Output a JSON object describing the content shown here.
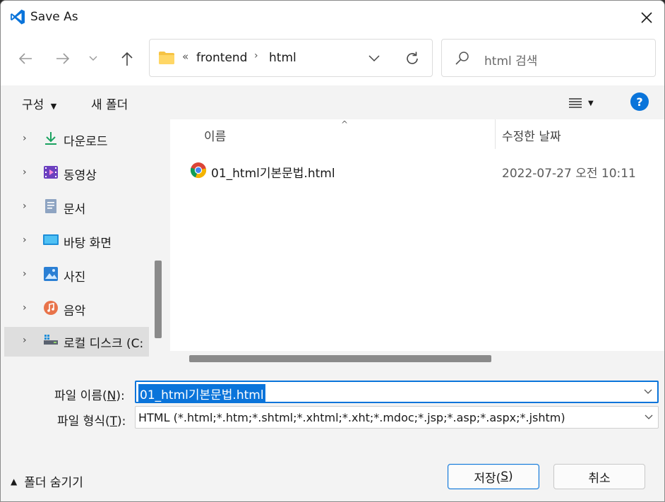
{
  "window": {
    "title": "Save As",
    "app_icon": "vscode-icon"
  },
  "nav": {
    "back_icon": "back-arrow-icon",
    "forward_icon": "forward-arrow-icon",
    "recent_icon": "chevron-down-icon",
    "up_icon": "up-arrow-icon"
  },
  "address": {
    "overflow": "«",
    "crumbs": [
      "frontend",
      "html"
    ],
    "separator": "›"
  },
  "search": {
    "placeholder": "html 검색"
  },
  "toolbar": {
    "organize_label": "구성",
    "new_folder_label": "새 폴더",
    "help_label": "?"
  },
  "sidebar": {
    "items": [
      {
        "label": "다운로드",
        "icon": "download-icon"
      },
      {
        "label": "동영상",
        "icon": "video-icon"
      },
      {
        "label": "문서",
        "icon": "document-icon"
      },
      {
        "label": "바탕 화면",
        "icon": "desktop-icon"
      },
      {
        "label": "사진",
        "icon": "pictures-icon"
      },
      {
        "label": "음악",
        "icon": "music-icon"
      },
      {
        "label": "로컬 디스크 (C:",
        "icon": "drive-icon",
        "selected": true
      }
    ]
  },
  "files": {
    "columns": {
      "name": "이름",
      "date": "수정한 날짜"
    },
    "rows": [
      {
        "name": "01_html기본문법.html",
        "date": "2022-07-27 오전 10:11",
        "icon": "chrome-icon"
      }
    ]
  },
  "form": {
    "filename_label_prefix": "파일 이름(",
    "filename_label_key": "N",
    "filename_label_suffix": "):",
    "filename_value": "01_html기본문법.html",
    "filetype_label_prefix": "파일 형식(",
    "filetype_label_key": "T",
    "filetype_label_suffix": "):",
    "filetype_value": "HTML (*.html;*.htm;*.shtml;*.xhtml;*.xht;*.mdoc;*.jsp;*.asp;*.aspx;*.jshtm)"
  },
  "footer": {
    "hide_folders_label": "폴더 숨기기",
    "save_prefix": "저장(",
    "save_key": "S",
    "save_suffix": ")",
    "cancel_label": "취소"
  },
  "colors": {
    "accent": "#0a74da",
    "folder": "#f6c344",
    "download": "#1aa260"
  }
}
